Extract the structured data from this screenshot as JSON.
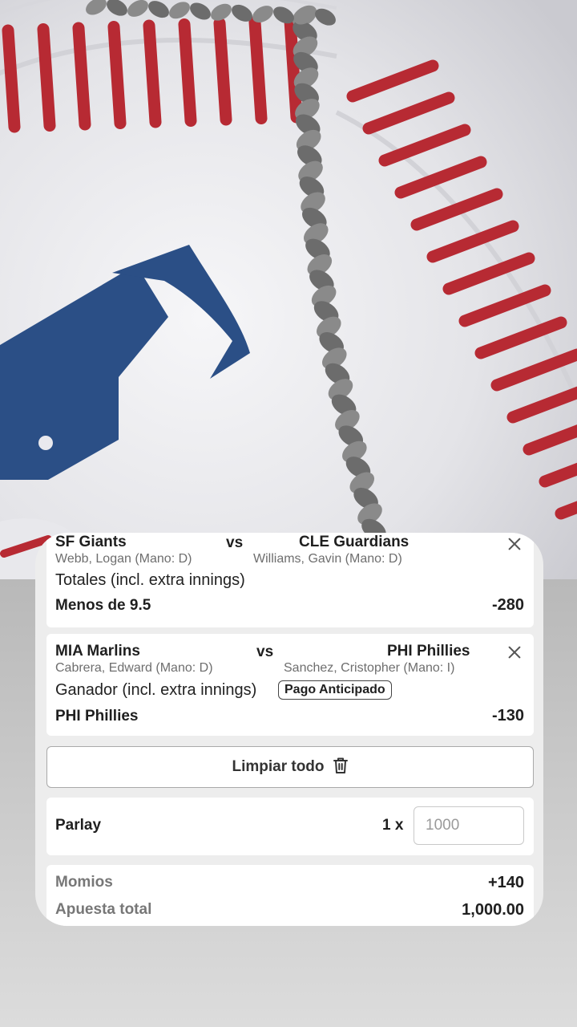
{
  "icons": {
    "close": "close-icon",
    "trash": "trash-icon",
    "logo": "mlb-logo"
  },
  "colors": {
    "stitch_red": "#b72a33",
    "logo_blue": "#2b4f86",
    "panel_bg": "#ededed",
    "card_bg": "#ffffff"
  },
  "bets": [
    {
      "home_team": "SF Giants",
      "vs": "vs",
      "away_team": "CLE Guardians",
      "home_pitcher": "Webb, Logan (Mano: D)",
      "away_pitcher": "Williams, Gavin (Mano: D)",
      "market": "Totales (incl. extra innings)",
      "pick": "Menos de 9.5",
      "odds": "-280"
    },
    {
      "home_team": "MIA Marlins",
      "vs": "vs",
      "away_team": "PHI Phillies",
      "home_pitcher": "Cabrera, Edward (Mano: D)",
      "away_pitcher": "Sanchez, Cristopher (Mano: I)",
      "market": "Ganador (incl. extra innings)",
      "badge": "Pago Anticipado",
      "pick": "PHI Phillies",
      "odds": "-130"
    }
  ],
  "clear_all_label": "Limpiar todo",
  "parlay": {
    "label": "Parlay",
    "multiplier": "1 x",
    "stake_placeholder": "1000"
  },
  "summary": {
    "odds_label": "Momios",
    "odds_value": "+140",
    "total_label": "Apuesta total",
    "total_value": "1,000.00"
  }
}
